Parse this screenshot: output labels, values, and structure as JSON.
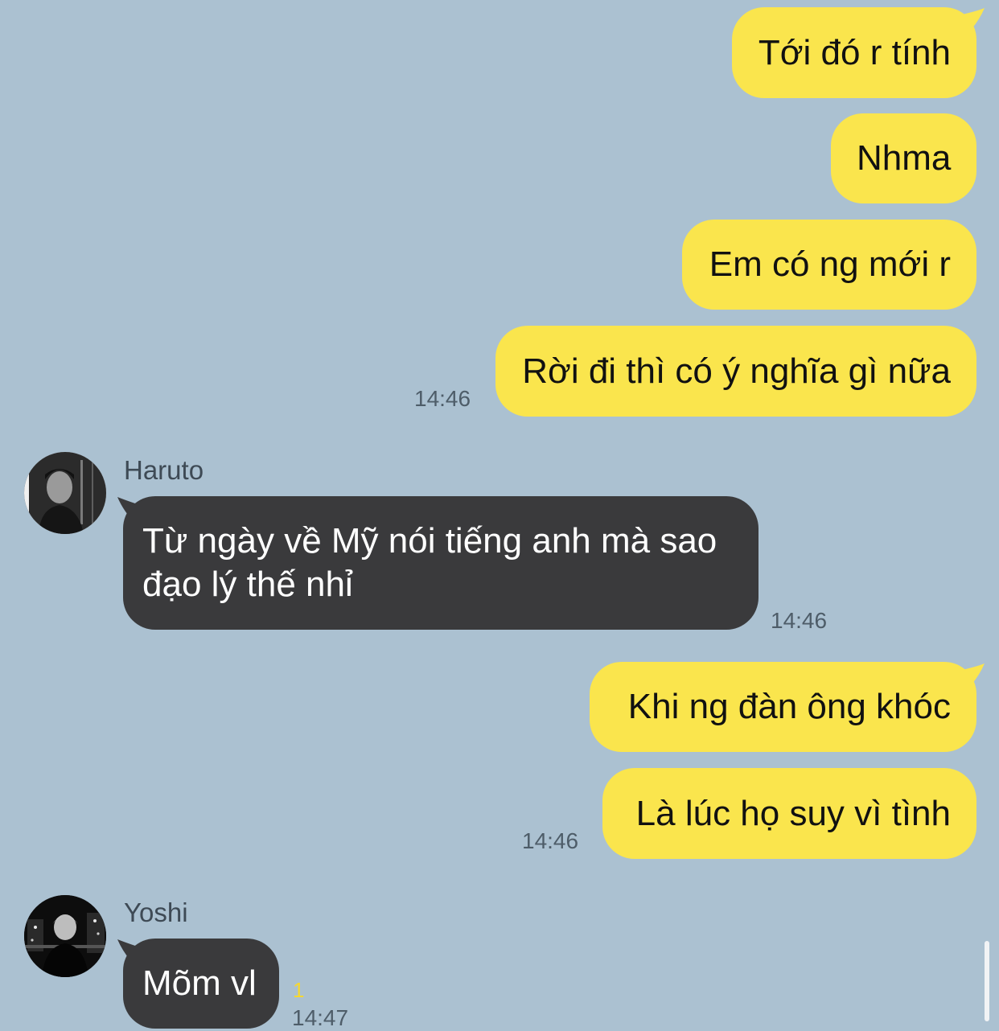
{
  "colors": {
    "background": "#abc1d1",
    "outgoing_bubble": "#fae54d",
    "incoming_bubble": "#3a3a3c",
    "timestamp": "#4e5d69",
    "unread_count": "#f7d82f"
  },
  "messages": {
    "out1": {
      "text": "Tới đó r tính"
    },
    "out2": {
      "text": "Nhma"
    },
    "out3": {
      "text": "Em có ng mới r"
    },
    "out4": {
      "text": "Rời đi thì có ý nghĩa gì nữa",
      "time": "14:46"
    },
    "in1": {
      "sender": "Haruto",
      "avatar": "avatar-photo-icon",
      "line1": "Từ ngày về Mỹ nói tiếng anh mà sao",
      "line2": "đạo lý thế nhỉ",
      "time": "14:46"
    },
    "out5": {
      "text": "Khi ng đàn ông khóc"
    },
    "out6": {
      "text": "Là lúc họ suy vì tình",
      "time": "14:46"
    },
    "in2": {
      "sender": "Yoshi",
      "avatar": "avatar-photo-icon",
      "text": "Mõm vl",
      "unread": "1",
      "time": "14:47"
    }
  }
}
